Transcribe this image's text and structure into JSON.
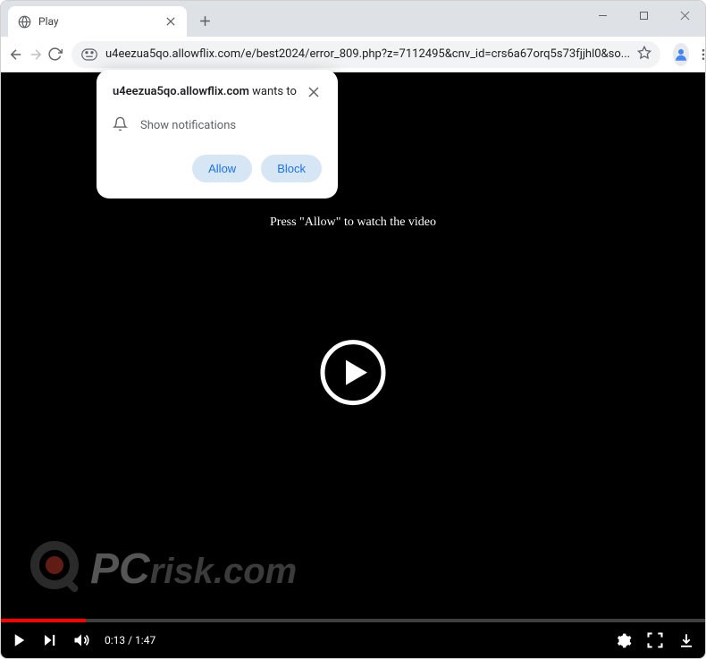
{
  "tab": {
    "title": "Play"
  },
  "omnibox": {
    "url": "u4eezua5qo.allowflix.com/e/best2024/error_809.php?z=7112495&cnv_id=crs6a67orq5s73fjjhl0&so..."
  },
  "permission": {
    "domain": "u4eezua5qo.allowflix.com",
    "wants_to": "wants to",
    "body": "Show notifications",
    "allow": "Allow",
    "block": "Block"
  },
  "page": {
    "press_allow": "Press \"Allow\" to watch the video"
  },
  "video": {
    "current_time": "0:13",
    "duration": "1:47",
    "progress_percent": 12,
    "progress_color": "#ff0000"
  },
  "watermark": {
    "text": "PCrisk.com"
  }
}
